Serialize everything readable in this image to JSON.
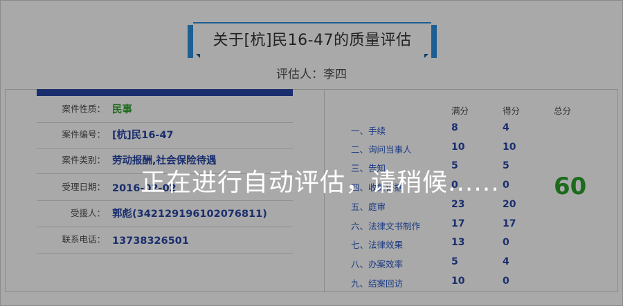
{
  "title": "关于[杭]民16-47的质量评估",
  "assessor": "评估人：李四",
  "case_info": [
    {
      "label": "案件性质：",
      "value": "民事",
      "green": true
    },
    {
      "label": "案件编号：",
      "value": "[杭]民16-47"
    },
    {
      "label": "案件类别：",
      "value": "劳动报酬,社会保险待遇"
    },
    {
      "label": "受理日期：",
      "value": "2016-02-02"
    },
    {
      "label": "受援人：",
      "value": "郭彪(342129196102076811)"
    },
    {
      "label": "联系电话：",
      "value": "13738326501"
    }
  ],
  "score_headers": {
    "full": "满分",
    "got": "得分",
    "total": "总分"
  },
  "items": [
    {
      "label": "一、手续",
      "full": "8",
      "got": "4"
    },
    {
      "label": "二、询问当事人",
      "full": "10",
      "got": "10"
    },
    {
      "label": "三、告知",
      "full": "5",
      "got": "5"
    },
    {
      "label": "四、收集证据",
      "full": "0",
      "got": "0"
    },
    {
      "label": "五、庭审",
      "full": "23",
      "got": "20"
    },
    {
      "label": "六、法律文书制作",
      "full": "17",
      "got": "17"
    },
    {
      "label": "七、法律效果",
      "full": "13",
      "got": "0"
    },
    {
      "label": "八、办案效率",
      "full": "5",
      "got": "4"
    },
    {
      "label": "九、结案回访",
      "full": "10",
      "got": "0"
    }
  ],
  "total_score": "60",
  "overlay_message": "正在进行自动评估，请稍候......"
}
